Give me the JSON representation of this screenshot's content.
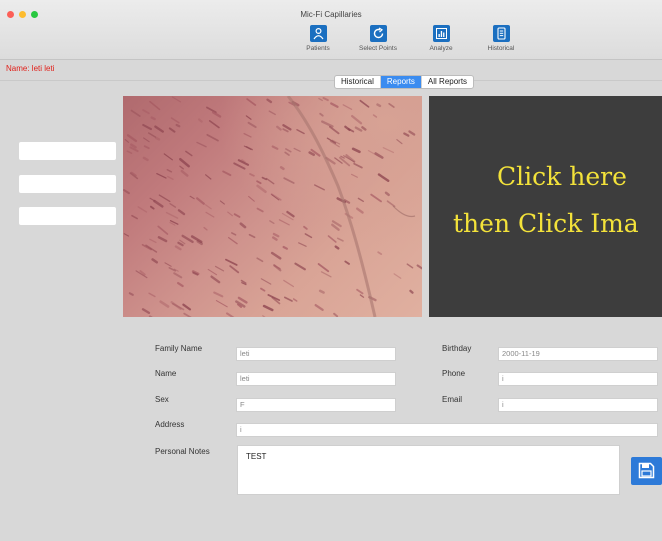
{
  "window": {
    "title": "Mic-Fi Capillaries"
  },
  "toolbar": {
    "items": [
      {
        "label": "Patients",
        "icon": "patients-icon"
      },
      {
        "label": "Select Points",
        "icon": "select-points-icon"
      },
      {
        "label": "Analyze",
        "icon": "analyze-icon"
      },
      {
        "label": "Historical",
        "icon": "historical-icon"
      }
    ]
  },
  "patient": {
    "name_line": "Name: leti leti"
  },
  "tabs": [
    {
      "label": "Historical",
      "active": false
    },
    {
      "label": "Reports",
      "active": true
    },
    {
      "label": "All Reports",
      "active": false
    }
  ],
  "overlay": {
    "line1": "Click here",
    "line2": "then Click Ima"
  },
  "form": {
    "family_name": {
      "label": "Family Name",
      "value": "leti"
    },
    "name": {
      "label": "Name",
      "value": "leti"
    },
    "sex": {
      "label": "Sex",
      "value": "F"
    },
    "address": {
      "label": "Address",
      "value": "i"
    },
    "birthday": {
      "label": "Birthday",
      "value": "2000-11-19"
    },
    "phone": {
      "label": "Phone",
      "value": "i"
    },
    "email": {
      "label": "Email",
      "value": "i"
    },
    "notes": {
      "label": "Personal Notes",
      "value": "TEST"
    }
  },
  "colors": {
    "accent": "#3b8cf0",
    "name_text": "#e0201a",
    "overlay_text": "#f3e23a",
    "dark_panel": "#3d3d3d"
  }
}
